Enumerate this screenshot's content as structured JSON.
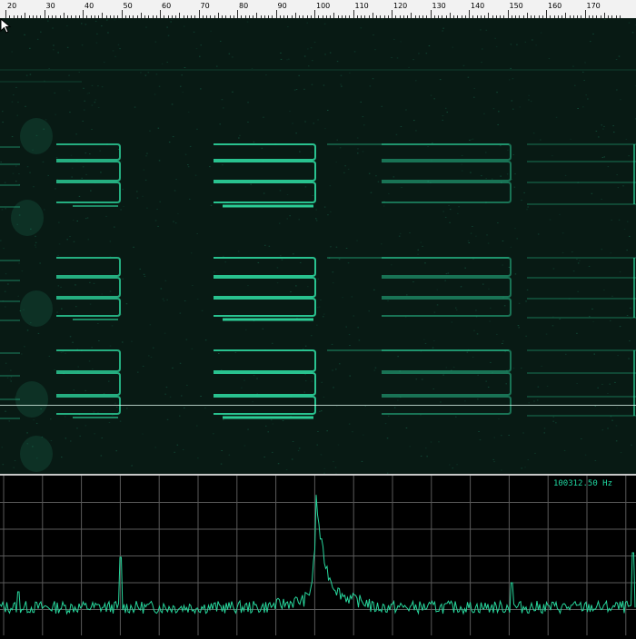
{
  "ruler": {
    "labels": [
      "20",
      "30",
      "40",
      "50",
      "60",
      "70",
      "80",
      "90",
      "100",
      "110",
      "120",
      "130",
      "140",
      "150",
      "160",
      "170"
    ]
  },
  "waterfall": {
    "trace_color": "#2fe0a4",
    "background_color": "#081a14"
  },
  "spectrum": {
    "readout": "100312.50 Hz",
    "trace_color": "#28d69c",
    "grid_color": "#5a5a5a"
  },
  "cursor": {
    "icon": "mouse-pointer-icon"
  }
}
